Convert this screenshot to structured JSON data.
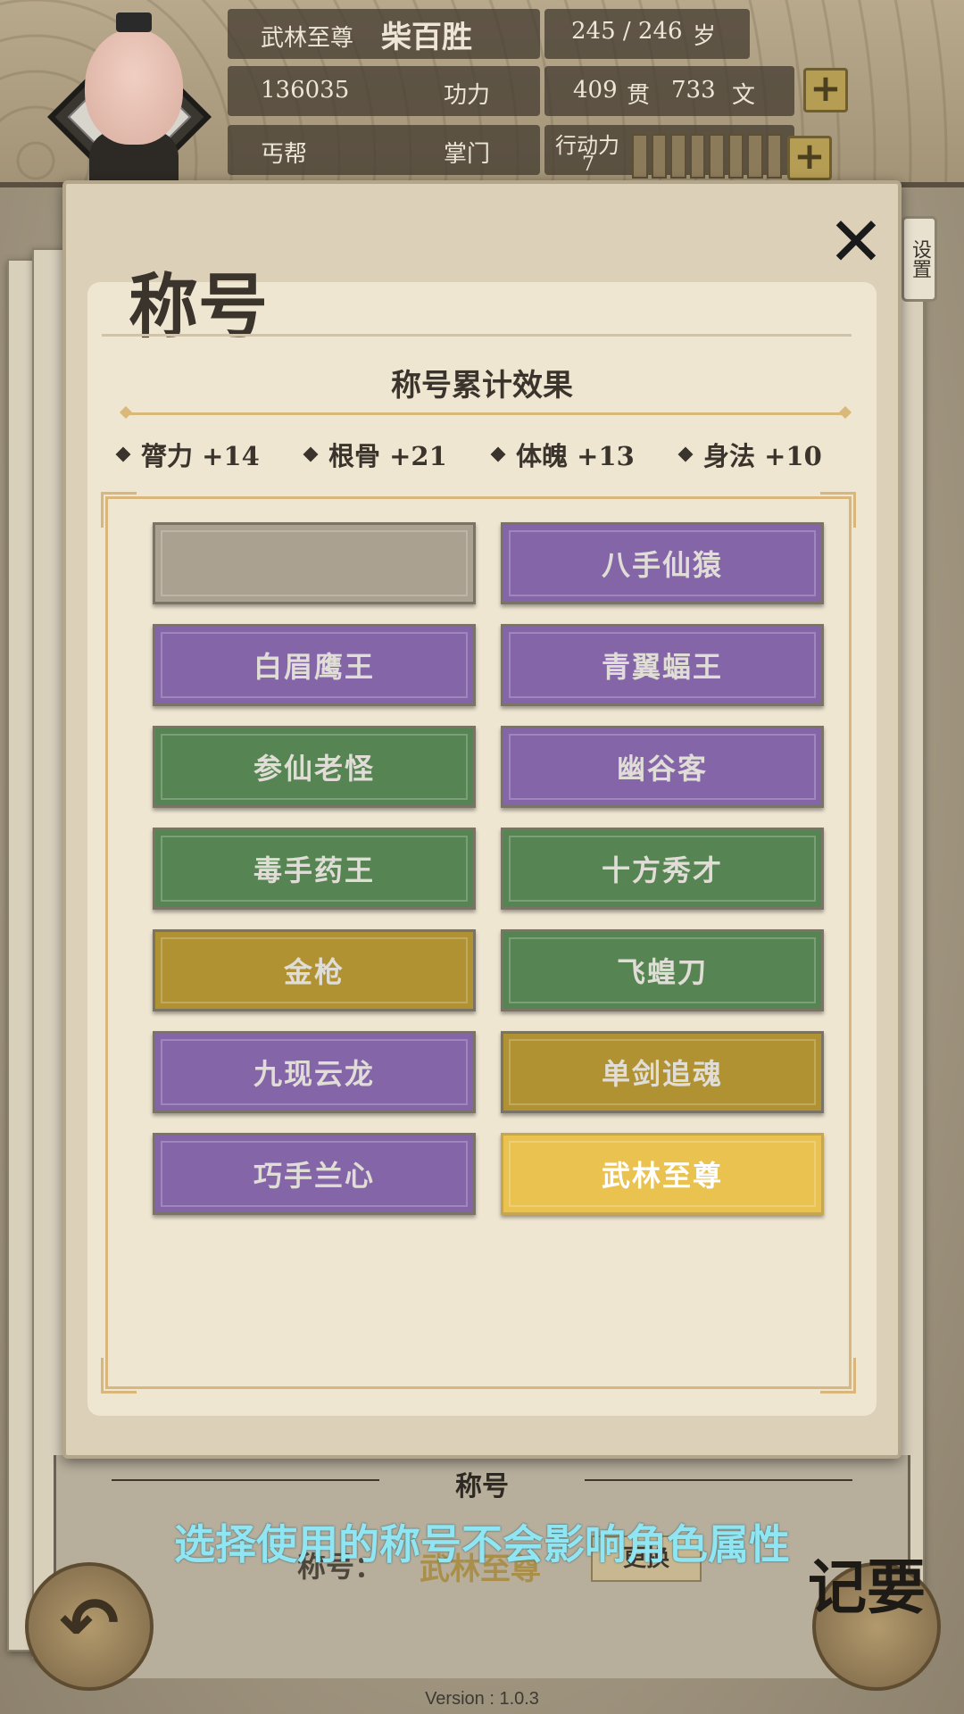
{
  "header": {
    "title_rank": "武林至尊",
    "name": "柴百胜",
    "age": "245 / 246",
    "age_unit": "岁",
    "power_value": "136035",
    "power_label": "功力",
    "money_guan": "409",
    "money_guan_unit": "贯",
    "money_wen": "733",
    "money_wen_unit": "文",
    "sect": "丐帮",
    "role": "掌门",
    "action_label": "行动力",
    "action_value": "7",
    "plus_symbol": "+"
  },
  "settings_tab": "设置",
  "panel": {
    "title": "称号",
    "close_symbol": "✕",
    "effects_title": "称号累计效果",
    "effects": [
      {
        "label": "膂力 +14"
      },
      {
        "label": "根骨 +21"
      },
      {
        "label": "体魄 +13"
      },
      {
        "label": "身法 +10"
      }
    ],
    "titles": [
      {
        "label": "",
        "color": "gray"
      },
      {
        "label": "八手仙猿",
        "color": "purple"
      },
      {
        "label": "白眉鹰王",
        "color": "purple"
      },
      {
        "label": "青翼蝠王",
        "color": "purple"
      },
      {
        "label": "参仙老怪",
        "color": "green"
      },
      {
        "label": "幽谷客",
        "color": "purple"
      },
      {
        "label": "毒手药王",
        "color": "green"
      },
      {
        "label": "十方秀才",
        "color": "green"
      },
      {
        "label": "金枪",
        "color": "olive"
      },
      {
        "label": "飞蝗刀",
        "color": "green"
      },
      {
        "label": "九现云龙",
        "color": "purple"
      },
      {
        "label": "单剑追魂",
        "color": "olive"
      },
      {
        "label": "巧手兰心",
        "color": "purple"
      },
      {
        "label": "武林至尊",
        "color": "yellow"
      }
    ]
  },
  "bottom": {
    "heading": "称号",
    "hint": "选择使用的称号不会影响角色属性",
    "current_label": "称号：",
    "current_value": "武林至尊",
    "change_label": "更换",
    "memo_label": "记要",
    "back_symbol": "↶",
    "version": "Version : 1.0.3"
  },
  "colors": {
    "purple": "#8466a8",
    "green": "#568453",
    "olive": "#b09232",
    "gray": "#aaa190",
    "yellow": "#e9c250",
    "hint": "#8fe6f2"
  }
}
